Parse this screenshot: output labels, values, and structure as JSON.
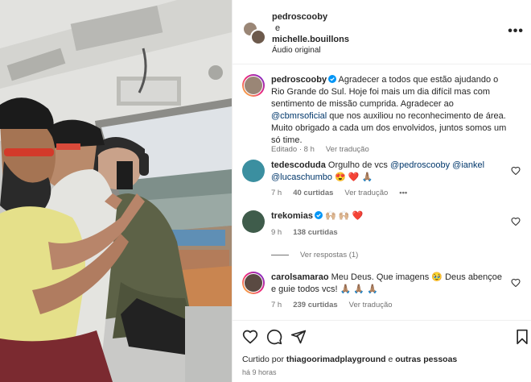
{
  "post": {
    "author": "pedroscooby",
    "conjunction": "e",
    "coauthor": "michelle.bouillons",
    "audio": "Áudio original",
    "more_icon": "more-horizontal-icon"
  },
  "caption": {
    "username": "pedroscooby",
    "text_1": " Agradecer a todos que estão ajudando o Rio Grande do Sul. Hoje foi mais um dia difícil mas com sentimento de missão cumprida. Agradecer ao ",
    "mention": "@cbmrsoficial",
    "text_2": " que nos auxiliou no reconhecimento de área. Muito obrigado a cada um dos envolvidos, juntos somos um só time.",
    "edited": "Editado · 8 h",
    "translate": "Ver tradução"
  },
  "comments": [
    {
      "username": "tedescoduda",
      "text": " Orgulho de vcs ",
      "mentions": [
        "@pedroscooby",
        "@iankel",
        "@lucaschumbo"
      ],
      "emoji": " 😍 ❤️ 🙏🏽",
      "time": "7 h",
      "likes": "40 curtidas",
      "translate": "Ver tradução",
      "more": "•••"
    },
    {
      "username": "trekomias",
      "text": " 🙌🏼 🙌🏼 ❤️",
      "time": "9 h",
      "likes": "138 curtidas"
    },
    {
      "username": "carolsamarao",
      "text": " Meu Deus. Que imagens 🥹 Deus abençoe e guie todos vcs! 🙏🏽 🙏🏽 🙏🏽",
      "time": "7 h",
      "likes": "239 curtidas",
      "translate": "Ver tradução"
    }
  ],
  "replies": "Ver respostas (1)",
  "actions": {
    "liked_by_label": "Curtido por ",
    "liked_by_user": "thiagoorimadplayground",
    "liked_and": " e ",
    "liked_others": "outras pessoas",
    "time_ago": "há 9 horas"
  },
  "colors": {
    "verified": "#0095f6",
    "mention": "#00376b",
    "secondary_text": "#737373"
  }
}
